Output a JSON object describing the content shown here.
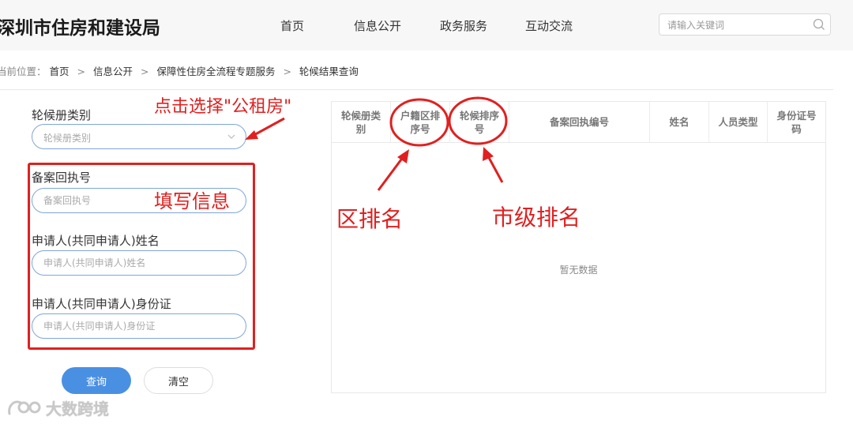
{
  "header": {
    "site_title": "深圳市住房和建设局",
    "nav": [
      "首页",
      "信息公开",
      "政务服务",
      "互动交流"
    ],
    "search_placeholder": "请输入关键词"
  },
  "breadcrumb": {
    "prefix": "当前位置：",
    "items": [
      "首页",
      "信息公开",
      "保障性住房全流程专题服务",
      "轮候结果查询"
    ],
    "separator": ">"
  },
  "form": {
    "category_label": "轮候册类别",
    "category_placeholder": "轮候册类别",
    "receipt_label": "备案回执号",
    "receipt_placeholder": "备案回执号",
    "name_label": "申请人(共同申请人)姓名",
    "name_placeholder": "申请人(共同申请人)姓名",
    "id_label": "申请人(共同申请人)身份证",
    "id_placeholder": "申请人(共同申请人)身份证",
    "query_button": "查询",
    "clear_button": "清空"
  },
  "table": {
    "headers": [
      "轮候册类别",
      "户籍区排序号",
      "轮候排序号",
      "备案回执编号",
      "姓名",
      "人员类型",
      "身份证号码"
    ],
    "empty_text": "暂无数据"
  },
  "annotations": {
    "select_hint": "点击选择\"公租房\"",
    "fill_hint": "填写信息",
    "district_rank": "区排名",
    "city_rank": "市级排名",
    "color": "#e02020"
  },
  "watermark": {
    "text": "大数跨境"
  },
  "colors": {
    "accent": "#4a90e2",
    "input_border": "#7fa6d9",
    "header_bg": "#f7f7f7"
  }
}
